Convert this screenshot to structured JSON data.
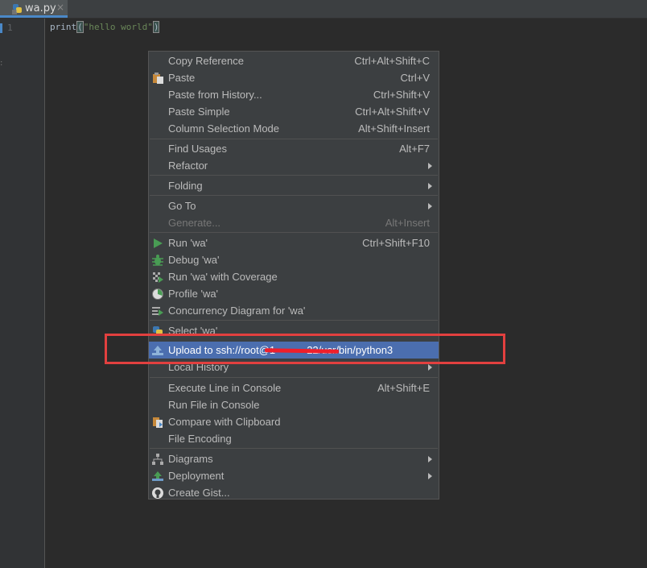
{
  "tab": {
    "filename": "wa.py",
    "close_glyph": "×"
  },
  "editor": {
    "line_number": "1",
    "code": {
      "func": "print",
      "open": "(",
      "string": "\"hello world\"",
      "close": ")"
    }
  },
  "menu": {
    "copy_reference": {
      "label": "Copy Reference",
      "shortcut": "Ctrl+Alt+Shift+C"
    },
    "paste": {
      "label": "Paste",
      "shortcut": "Ctrl+V",
      "icon": "paste-icon"
    },
    "paste_history": {
      "label": "Paste from History...",
      "shortcut": "Ctrl+Shift+V"
    },
    "paste_simple": {
      "label": "Paste Simple",
      "shortcut": "Ctrl+Alt+Shift+V"
    },
    "column_selection": {
      "label": "Column Selection Mode",
      "shortcut": "Alt+Shift+Insert"
    },
    "find_usages": {
      "label": "Find Usages",
      "shortcut": "Alt+F7"
    },
    "refactor": {
      "label": "Refactor"
    },
    "folding": {
      "label": "Folding"
    },
    "go_to": {
      "label": "Go To"
    },
    "generate": {
      "label": "Generate...",
      "shortcut": "Alt+Insert"
    },
    "run": {
      "label": "Run 'wa'",
      "shortcut": "Ctrl+Shift+F10",
      "icon": "run-icon"
    },
    "debug": {
      "label": "Debug 'wa'",
      "icon": "debug-icon"
    },
    "coverage": {
      "label": "Run 'wa' with Coverage",
      "icon": "coverage-icon"
    },
    "profile": {
      "label": "Profile 'wa'",
      "icon": "profile-icon"
    },
    "concurrency": {
      "label": "Concurrency Diagram for 'wa'",
      "icon": "concurrency-icon"
    },
    "select": {
      "label": "Select 'wa'",
      "icon": "python-icon"
    },
    "upload": {
      "label": "Upload to ssh://root@1               22/usr/bin/python3",
      "icon": "upload-icon"
    },
    "local_history": {
      "label": "Local History"
    },
    "execute_line": {
      "label": "Execute Line in Console",
      "shortcut": "Alt+Shift+E"
    },
    "run_file": {
      "label": "Run File in Console"
    },
    "compare_clipboard": {
      "label": "Compare with Clipboard",
      "icon": "compare-icon"
    },
    "file_encoding": {
      "label": "File Encoding"
    },
    "diagrams": {
      "label": "Diagrams",
      "icon": "diagram-icon"
    },
    "deployment": {
      "label": "Deployment",
      "icon": "deployment-icon"
    },
    "create_gist": {
      "label": "Create Gist...",
      "icon": "github-icon"
    }
  },
  "colors": {
    "selection": "#4b6eaf",
    "annotation": "#e2403f",
    "run_green": "#499c54"
  }
}
